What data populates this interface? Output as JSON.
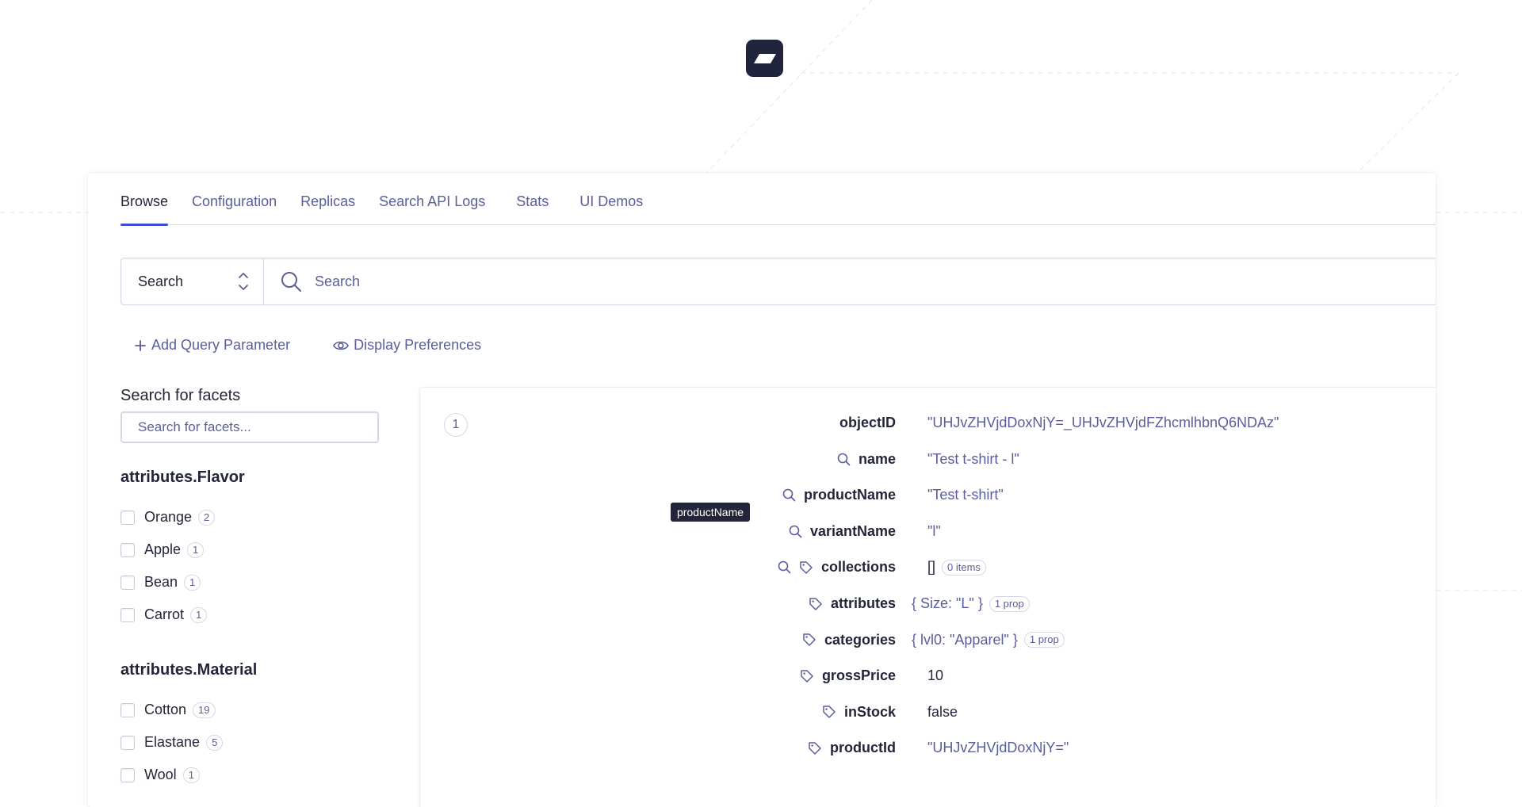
{
  "tabs": [
    {
      "label": "Browse",
      "active": true
    },
    {
      "label": "Configuration",
      "active": false
    },
    {
      "label": "Replicas",
      "active": false
    },
    {
      "label": "Search API Logs",
      "active": false
    },
    {
      "label": "Stats",
      "active": false
    },
    {
      "label": "UI Demos",
      "active": false
    }
  ],
  "search": {
    "mode": "Search",
    "placeholder": "Search"
  },
  "actions": {
    "add_query_parameter": "Add Query Parameter",
    "display_preferences": "Display Preferences"
  },
  "facets": {
    "title": "Search for facets",
    "placeholder": "Search for facets...",
    "groups": [
      {
        "name": "attributes.Flavor",
        "items": [
          {
            "label": "Orange",
            "count": "2"
          },
          {
            "label": "Apple",
            "count": "1"
          },
          {
            "label": "Bean",
            "count": "1"
          },
          {
            "label": "Carrot",
            "count": "1"
          }
        ]
      },
      {
        "name": "attributes.Material",
        "items": [
          {
            "label": "Cotton",
            "count": "19"
          },
          {
            "label": "Elastane",
            "count": "5"
          },
          {
            "label": "Wool",
            "count": "1"
          }
        ]
      }
    ]
  },
  "hit": {
    "index": "1",
    "attributes": [
      {
        "key": "objectID",
        "value": "\"UHJvZHVjdDoxNjY=_UHJvZHVjdFZhcmlhbnQ6NDAz\"",
        "icons": [],
        "badge": ""
      },
      {
        "key": "name",
        "value": "\"Test t-shirt - l\"",
        "icons": [
          "search-icon"
        ],
        "badge": ""
      },
      {
        "key": "productName",
        "value": "\"Test t-shirt\"",
        "icons": [
          "search-icon"
        ],
        "badge": ""
      },
      {
        "key": "variantName",
        "value": "\"l\"",
        "icons": [
          "search-icon"
        ],
        "badge": ""
      },
      {
        "key": "collections",
        "value": "[]",
        "icons": [
          "search-icon",
          "tag-icon"
        ],
        "badge": "0 items"
      },
      {
        "key": "attributes",
        "value": "{ Size: \"L\" }",
        "icons": [
          "tag-icon"
        ],
        "badge": "1 prop"
      },
      {
        "key": "categories",
        "value": "{ lvl0: \"Apparel\" }",
        "icons": [
          "tag-icon"
        ],
        "badge": "1 prop"
      },
      {
        "key": "grossPrice",
        "value": "10",
        "icons": [
          "tag-icon"
        ],
        "badge": ""
      },
      {
        "key": "inStock",
        "value": "false",
        "icons": [
          "tag-icon"
        ],
        "badge": ""
      },
      {
        "key": "productId",
        "value": "\"UHJvZHVjdDoxNjY=\"",
        "icons": [
          "tag-icon"
        ],
        "badge": ""
      }
    ]
  },
  "tooltip": "productName",
  "colors": {
    "accent": "#3a4ecf",
    "text": "#23263b",
    "muted": "#5a5e9a",
    "border": "#d6d6e7"
  }
}
